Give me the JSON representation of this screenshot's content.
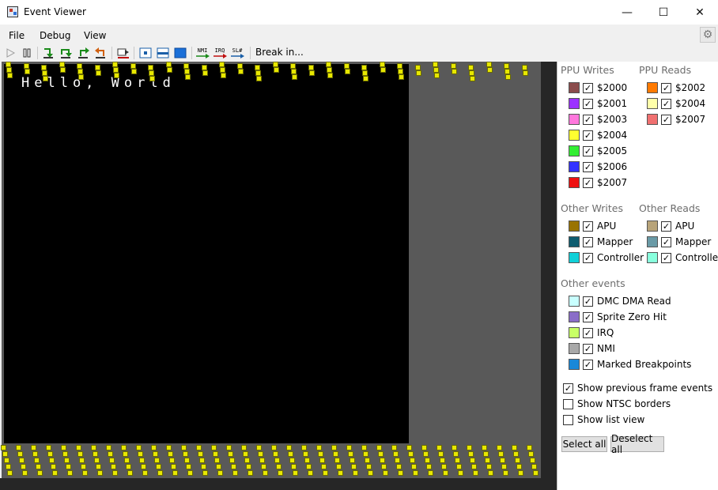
{
  "window": {
    "title": "Event Viewer",
    "minimize_glyph": "—",
    "maximize_glyph": "☐",
    "close_glyph": "✕"
  },
  "menu": {
    "items": [
      "File",
      "Debug",
      "View"
    ],
    "settings_icon": "gear-icon"
  },
  "toolbar": {
    "break_in_label": "Break in...",
    "nmi_label": "NMI",
    "irq_label": "IRQ",
    "sl_label": "SL#"
  },
  "viewer": {
    "screen_text": "Hello, World",
    "colors": {
      "background": "#000000",
      "overscan": "#595959",
      "event_dot": "#e8e800"
    }
  },
  "panel": {
    "ppu_writes": {
      "title": "PPU Writes",
      "items": [
        {
          "label": "$2000",
          "color": "#8b4c4c",
          "checked": true
        },
        {
          "label": "$2001",
          "color": "#9b30ff",
          "checked": true
        },
        {
          "label": "$2003",
          "color": "#ff77dd",
          "checked": true
        },
        {
          "label": "$2004",
          "color": "#ffff30",
          "checked": true
        },
        {
          "label": "$2005",
          "color": "#33ee33",
          "checked": true
        },
        {
          "label": "$2006",
          "color": "#3333ff",
          "checked": true
        },
        {
          "label": "$2007",
          "color": "#ee1111",
          "checked": true
        }
      ]
    },
    "ppu_reads": {
      "title": "PPU Reads",
      "items": [
        {
          "label": "$2002",
          "color": "#ff7a00",
          "checked": true
        },
        {
          "label": "$2004",
          "color": "#ffffaa",
          "checked": true
        },
        {
          "label": "$2007",
          "color": "#f07070",
          "checked": true
        }
      ]
    },
    "other_writes": {
      "title": "Other Writes",
      "items": [
        {
          "label": "APU",
          "color": "#997300",
          "checked": true
        },
        {
          "label": "Mapper",
          "color": "#0f5d70",
          "checked": true
        },
        {
          "label": "Controller",
          "color": "#10d0d8",
          "checked": true
        }
      ]
    },
    "other_reads": {
      "title": "Other Reads",
      "items": [
        {
          "label": "APU",
          "color": "#b8a47a",
          "checked": true
        },
        {
          "label": "Mapper",
          "color": "#6a9aa6",
          "checked": true
        },
        {
          "label": "Controller",
          "color": "#88ffdd",
          "checked": true
        }
      ]
    },
    "other_events": {
      "title": "Other events",
      "items": [
        {
          "label": "DMC DMA Read",
          "color": "#c8ffff",
          "checked": true
        },
        {
          "label": "Sprite Zero Hit",
          "color": "#8a6dc8",
          "checked": true
        },
        {
          "label": "IRQ",
          "color": "#c8ff66",
          "checked": true
        },
        {
          "label": "NMI",
          "color": "#a8a8a8",
          "checked": true
        },
        {
          "label": "Marked Breakpoints",
          "color": "#1a88d8",
          "checked": true
        }
      ]
    },
    "options": [
      {
        "label": "Show previous frame events",
        "checked": true
      },
      {
        "label": "Show NTSC borders",
        "checked": false
      },
      {
        "label": "Show list view",
        "checked": false
      }
    ],
    "select_all_label": "Select all",
    "deselect_all_label": "Deselect all"
  }
}
